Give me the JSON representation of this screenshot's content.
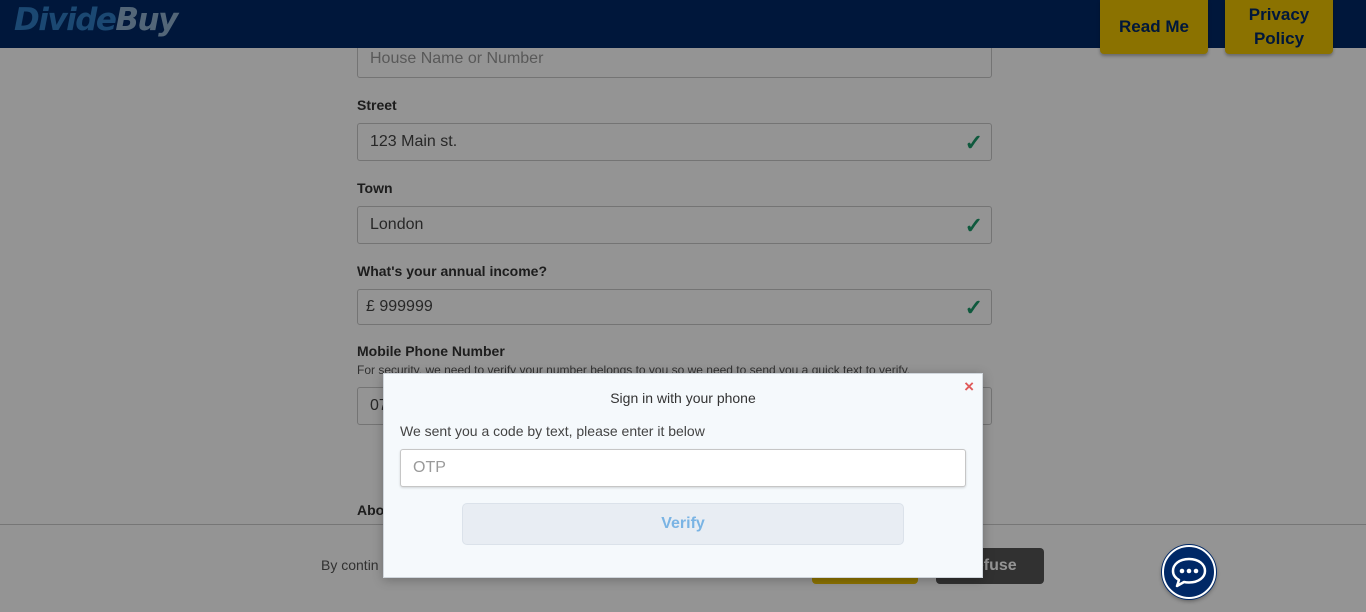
{
  "header": {
    "logo_part1": "Divide",
    "logo_part2": "Buy",
    "read_me": "Read Me",
    "privacy_policy": "Privacy Policy"
  },
  "form": {
    "house_placeholder": "House Name or Number",
    "street_label": "Street",
    "street_value": "123 Main st.",
    "town_label": "Town",
    "town_value": "London",
    "income_label": "What's your annual income?",
    "income_value": "£ 999999",
    "phone_label": "Mobile Phone Number",
    "phone_hint": "For security, we need to verify your number belongs to you so we need to send you a quick text to verify.",
    "phone_value": "07",
    "about_label": "Abo",
    "check_glyph": "✓"
  },
  "cookie": {
    "text": "By contin",
    "accept": "",
    "refuse": "Refuse"
  },
  "modal": {
    "close_glyph": "×",
    "title": "Sign in with your phone",
    "text": "We sent you a code by text, please enter it below",
    "otp_placeholder": "OTP",
    "verify_label": "Verify"
  },
  "colors": {
    "brand_navy": "#002866",
    "brand_yellow": "#f0c400",
    "check_green": "#1a9a6a",
    "close_red": "#e05a5a"
  },
  "icons": {
    "chat": "chat-bubble-icon",
    "check": "check-icon",
    "close": "close-icon"
  }
}
